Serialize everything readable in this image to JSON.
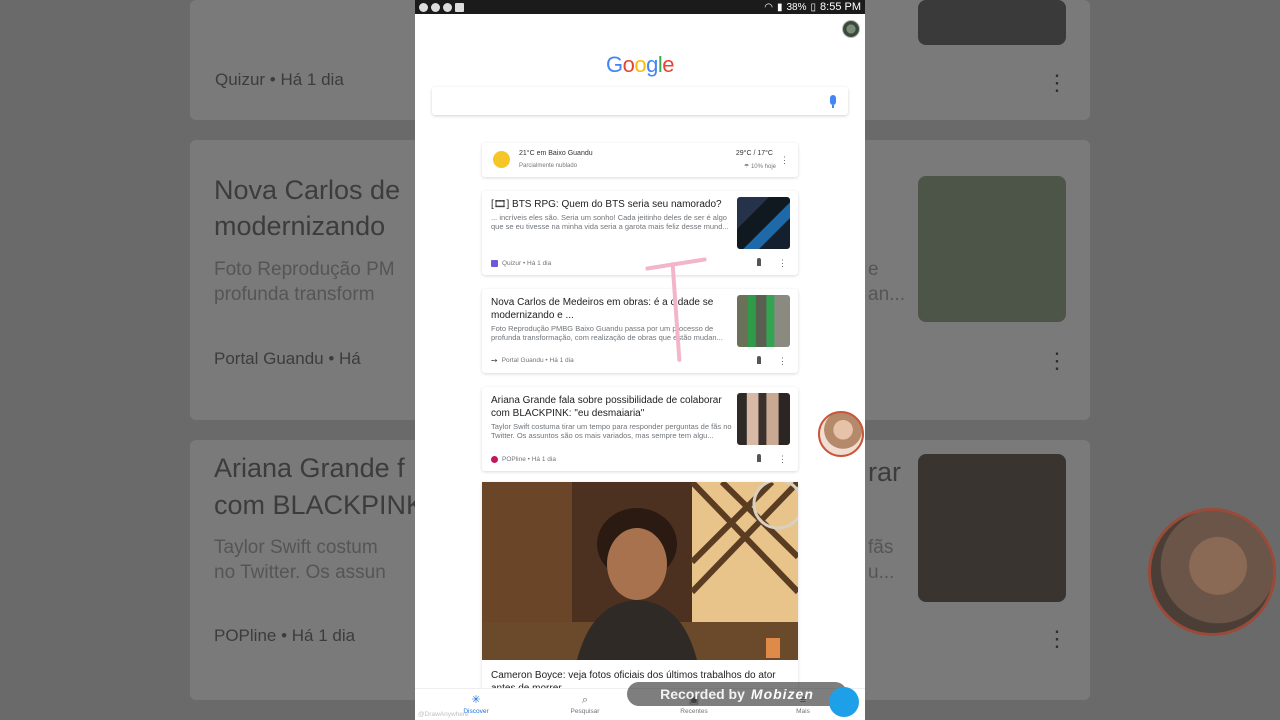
{
  "status_bar": {
    "battery": "38%",
    "time": "8:55 PM"
  },
  "google_logo": [
    "G",
    "o",
    "o",
    "g",
    "l",
    "e"
  ],
  "search": {
    "placeholder": "",
    "mic_icon": "mic-icon"
  },
  "weather": {
    "title": "21°C em Baixo Guandu",
    "subtitle": "Parcialmente nublado",
    "high_low": "29°C / 17°C",
    "rain": "10% hoje"
  },
  "cards": [
    {
      "headline": "[🎞] BTS RPG: Quem do BTS seria seu namorado?",
      "snippet": "... incríveis eles são. Seria um sonho! Cada jeitinho deles de ser é algo que se eu tivesse na minha vida seria a garota mais feliz desse mund...",
      "source": "Quizur • Há 1 dia",
      "source_color": "#6b5bd6"
    },
    {
      "headline": "Nova Carlos de Medeiros em obras: é a cidade se modernizando e ...",
      "snippet": "Foto Reprodução PMBG Baixo Guandu passa por um processo de profunda transformação, com realização de obras que estão mudan...",
      "source": "Portal Guandu • Há 1 dia",
      "source_color": "#444444"
    },
    {
      "headline": "Ariana Grande fala sobre possibilidade de colaborar com BLACKPINK: \"eu desmaiaria\"",
      "snippet": "Taylor Swift costuma tirar um tempo para responder perguntas de fãs no Twitter. Os assuntos são os mais variados, mas sempre tem algu...",
      "source": "POPline • Há 1 dia",
      "source_color": "#c2185b"
    }
  ],
  "hero": {
    "title": "Cameron Boyce: veja fotos oficiais dos últimos trabalhos do ator antes de morrer"
  },
  "background": {
    "source1": "Quizur • Há 1 dia",
    "headline2_line1": "Nova Carlos de",
    "headline2_line2": "modernizando",
    "snippet2_line1": "Foto Reprodução PM",
    "snippet2_line2": "profunda transform",
    "source2": "Portal Guandu • Há",
    "headline3_line1": "Ariana Grande f",
    "headline3_line2": "com BLACKPINK",
    "snippet3_line1": "Taylor Swift costum",
    "snippet3_line2": "no Twitter. Os assun",
    "source3": "POPline • Há 1 dia",
    "right_frag1": "e",
    "right_frag2": "an...",
    "right_frag3": "rar",
    "right_frag4": "fãs",
    "right_frag5": "u..."
  },
  "bottom_nav": [
    {
      "label": "Discover",
      "icon": "asterisk-icon",
      "active": true
    },
    {
      "label": "Pesquisar",
      "icon": "search-icon",
      "active": false
    },
    {
      "label": "Recentes",
      "icon": "recent-icon",
      "active": false
    },
    {
      "label": "Mais",
      "icon": "more-icon",
      "active": false
    }
  ],
  "overlay": {
    "recorded_prefix": "Recorded by",
    "recorded_brand": "Mobizen",
    "watermark": "@DrawAnywhere"
  }
}
